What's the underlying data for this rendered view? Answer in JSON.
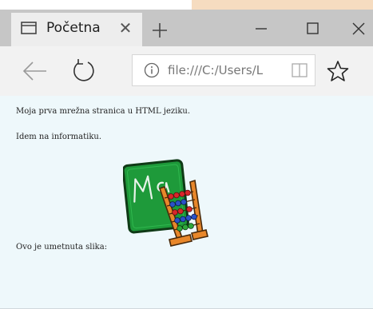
{
  "browser": {
    "tab": {
      "title": "Početna",
      "close_glyph": "✕",
      "icon": "page-icon"
    },
    "new_tab_icon": "plus-icon",
    "window_controls": [
      "minimize-icon",
      "maximize-icon",
      "close-icon"
    ],
    "toolbar": {
      "back_icon": "back-arrow-icon",
      "refresh_icon": "refresh-icon",
      "address": {
        "info_icon": "info-icon",
        "url": "file:///C:/Users/L",
        "reading_view_icon": "reading-view-icon"
      },
      "favorite_icon": "star-icon"
    },
    "colors": {
      "titlebar": "#c6c6c6",
      "tab_active": "#ededed",
      "toolbar": "#f2f2f2",
      "content_bg": "#eef8fb",
      "chalkboard": "#1e9a3a",
      "abacus_frame": "#e8872a"
    }
  },
  "page": {
    "line1": "Moja prva mrežna stranica u HTML jeziku.",
    "line2": "Idem na informatiku.",
    "image_caption": "Ovo je umetnuta slika:",
    "image": {
      "description_icon": "abacus-chalkboard-image",
      "chalk_text": "Ma"
    }
  }
}
